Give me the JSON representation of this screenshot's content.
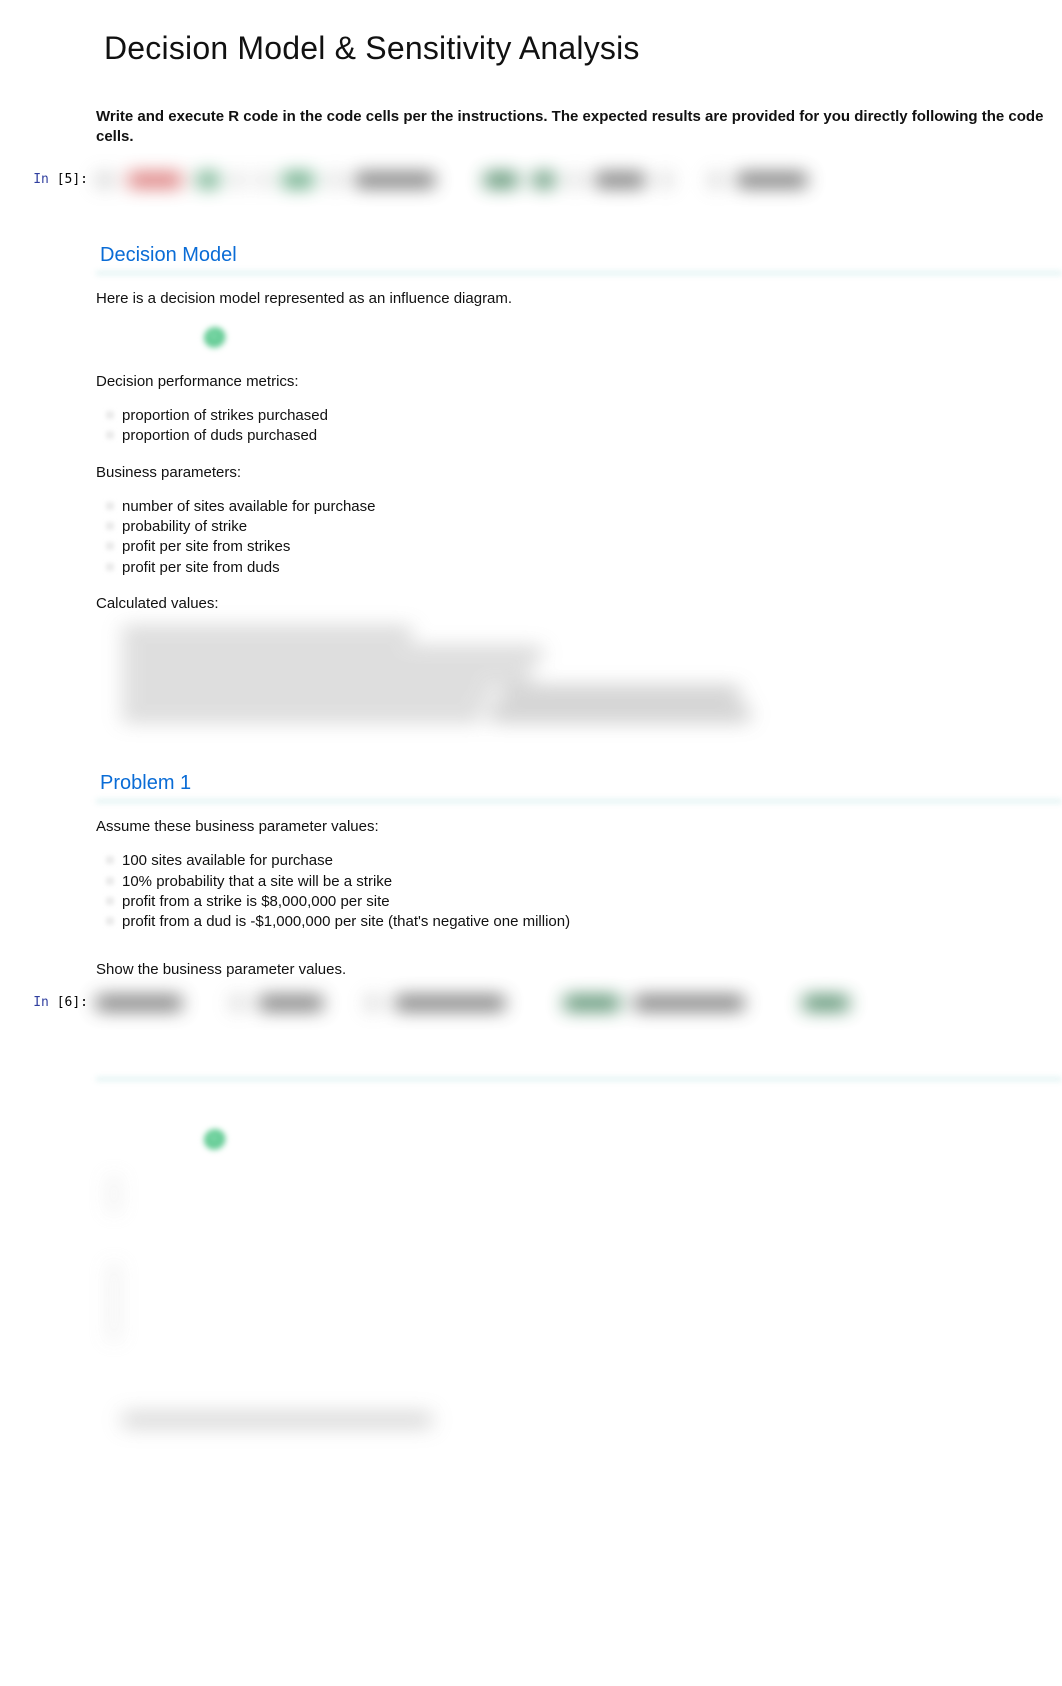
{
  "title": "Decision Model & Sensitivity Analysis",
  "instruction": "Write and execute R code in the code cells per the instructions. The expected results are provided for you directly following the code cells.",
  "cells": {
    "c1": {
      "prompt_in": "In",
      "prompt_num": "[5]:"
    },
    "c2": {
      "prompt_in": "In",
      "prompt_num": "[6]:"
    }
  },
  "section1": {
    "heading": "Decision Model",
    "intro": "Here is a decision model represented as an influence diagram.",
    "metrics_label": "Decision performance metrics:",
    "metrics": [
      "proportion of strikes purchased",
      "proportion of duds purchased"
    ],
    "params_label": "Business parameters:",
    "params": [
      "number of sites available for purchase",
      "probability of strike",
      "profit per site from strikes",
      "profit per site from duds"
    ],
    "calc_label": "Calculated values:"
  },
  "section2": {
    "heading": "Problem 1",
    "intro": "Assume these business parameter values:",
    "values": [
      "100 sites available for purchase",
      "10% probability that a site will be a strike",
      "profit from a strike is $8,000,000 per site",
      "profit from a dud is -$1,000,000 per site (that's negative one million)"
    ],
    "task": "Show the business parameter values."
  }
}
